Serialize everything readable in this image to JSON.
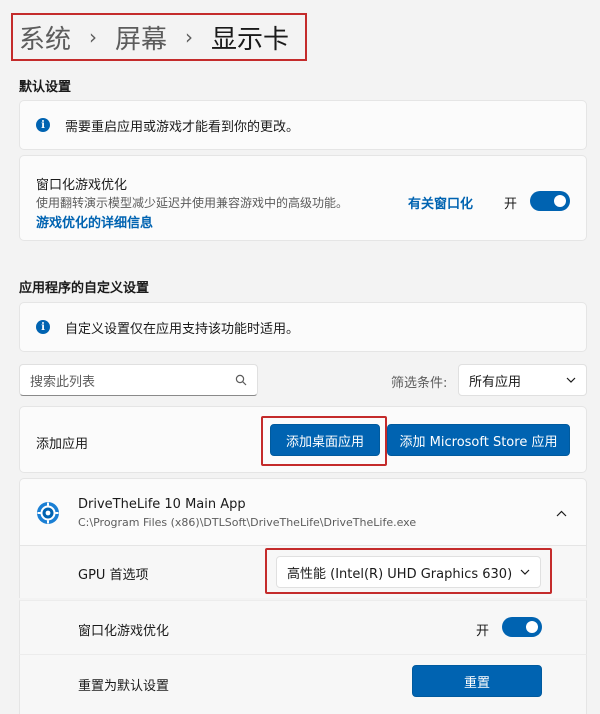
{
  "breadcrumb": {
    "part1": "系统",
    "part2": "屏幕",
    "current": "显示卡",
    "sep": "›"
  },
  "default_settings": {
    "title": "默认设置",
    "info_text": "需要重启应用或游戏才能看到你的更改。",
    "windowed": {
      "title": "窗口化游戏优化",
      "desc": "使用翻转演示模型减少延迟并使用兼容游戏中的高级功能。",
      "link_part1": "有关窗口化",
      "link_part2": "游戏优化的详细信息",
      "toggle_label": "开"
    }
  },
  "custom_settings": {
    "title": "应用程序的自定义设置",
    "info_text": "自定义设置仅在应用支持该功能时适用。",
    "search_placeholder": "搜索此列表",
    "filter_label": "筛选条件:",
    "filter_value": "所有应用",
    "add_app_label": "添加应用",
    "add_desktop_button": "添加桌面应用",
    "add_store_button": "添加 Microsoft Store 应用"
  },
  "app_entry": {
    "name": "DriveTheLife 10 Main App",
    "path": "C:\\Program Files (x86)\\DTLSoft\\DriveTheLife\\DriveTheLife.exe",
    "gpu_label": "GPU 首选项",
    "gpu_value": "高性能 (Intel(R) UHD Graphics 630)",
    "windowed_label": "窗口化游戏优化",
    "windowed_toggle_label": "开",
    "reset_label": "重置为默认设置",
    "reset_button": "重置"
  },
  "icons": {
    "info": "i",
    "search": "search-icon",
    "chevron_down": "chevron-down-icon",
    "chevron_up": "chevron-up-icon",
    "app": "gear-app-icon"
  },
  "colors": {
    "accent": "#0063b1",
    "highlight": "#c42b2b"
  }
}
